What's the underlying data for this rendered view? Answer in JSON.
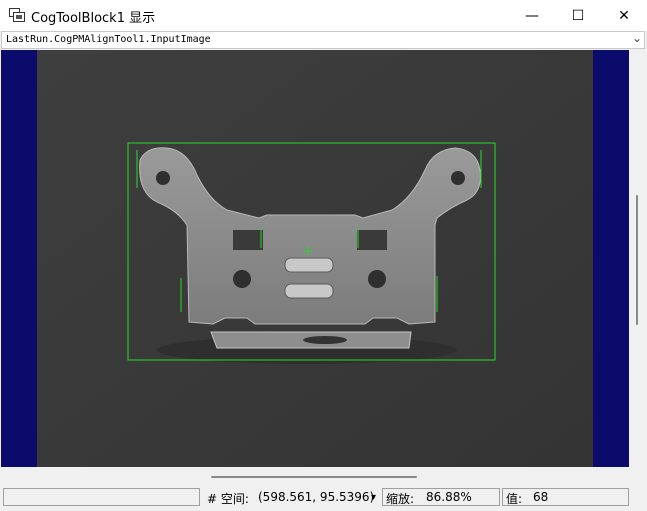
{
  "window": {
    "title": "CogToolBlock1 显示",
    "icon": "app-window-icon",
    "minimize_glyph": "—",
    "maximize_glyph": "☐",
    "close_glyph": "✕"
  },
  "image_selector": {
    "value": "LastRun.CogPMAlignTool1.InputImage",
    "arrow_glyph": "⌄"
  },
  "status": {
    "space_label": "# 空间:",
    "space_value": "(598.561, 95.5396)",
    "space_arrow": "▾",
    "zoom_label": "缩放:",
    "zoom_value": "86.88%",
    "pixel_label": "值:",
    "pixel_value": "68"
  },
  "colors": {
    "viewer_background": "#0b0b6b",
    "overlay_green": "#22dd22",
    "camera_background": "#3a3a3a"
  }
}
